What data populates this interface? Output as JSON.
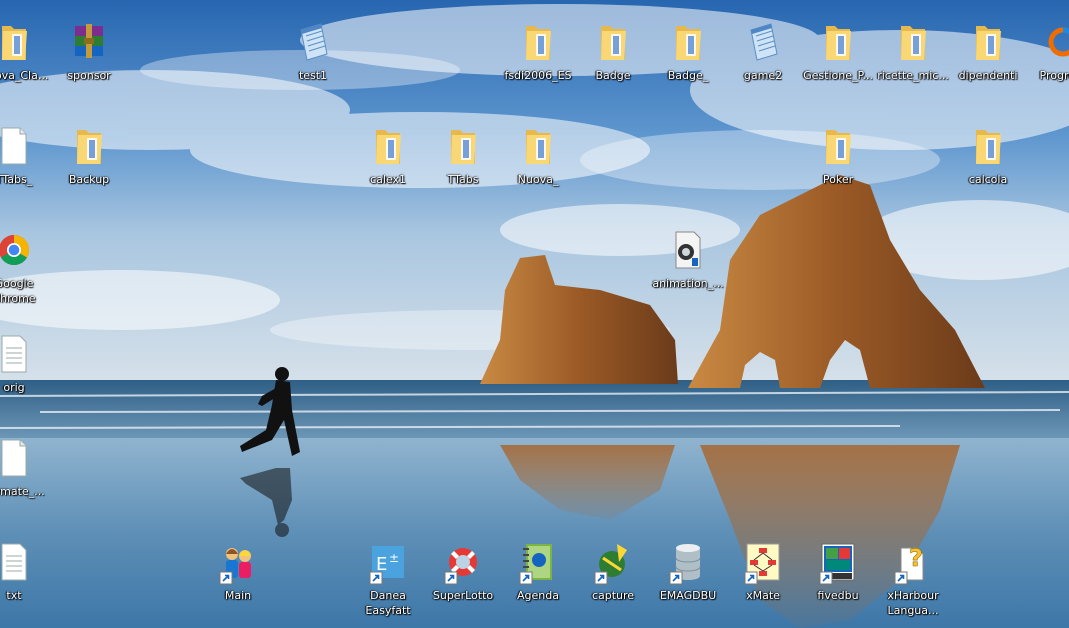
{
  "desktop": {
    "icons": [
      {
        "label": "Nuova_Cla...",
        "icon": "folder-icon"
      },
      {
        "label": "sponsor",
        "icon": "winrar-archive-icon"
      },
      {
        "label": "test1",
        "icon": "notepad-icon"
      },
      {
        "label": "fsdi2006_ES",
        "icon": "folder-icon"
      },
      {
        "label": "Badge",
        "icon": "folder-icon"
      },
      {
        "label": "Badge_",
        "icon": "folder-icon"
      },
      {
        "label": "game2",
        "icon": "notepad-icon"
      },
      {
        "label": "Gestione_P...",
        "icon": "folder-icon"
      },
      {
        "label": "ricette_mic...",
        "icon": "folder-icon"
      },
      {
        "label": "dipendenti",
        "icon": "folder-icon"
      },
      {
        "label": "Progress",
        "icon": "progress-app-icon"
      },
      {
        "label": "TTabs_",
        "icon": "document-icon"
      },
      {
        "label": "Backup",
        "icon": "folder-icon"
      },
      {
        "label": "calex1",
        "icon": "folder-icon"
      },
      {
        "label": "TTabs",
        "icon": "folder-icon"
      },
      {
        "label": "Nuova_",
        "icon": "folder-icon"
      },
      {
        "label": "Poker",
        "icon": "folder-icon"
      },
      {
        "label": "calcola",
        "icon": "folder-icon"
      },
      {
        "label": "Google Chrome",
        "icon": "chrome-icon"
      },
      {
        "label": "animation_...",
        "icon": "animation-file-icon"
      },
      {
        "label": "orig",
        "icon": "text-file-icon"
      },
      {
        "label": "Fermate_...",
        "icon": "document-icon"
      },
      {
        "label": "txt",
        "icon": "text-file-icon"
      },
      {
        "label": "Main",
        "icon": "people-app-icon"
      },
      {
        "label": "Danea Easyfatt",
        "icon": "easyfatt-app-icon"
      },
      {
        "label": "SuperLotto",
        "icon": "lifebuoy-icon"
      },
      {
        "label": "Agenda",
        "icon": "agenda-notebook-icon"
      },
      {
        "label": "capture",
        "icon": "capture-app-icon"
      },
      {
        "label": "EMAGDBU",
        "icon": "database-icon"
      },
      {
        "label": "xMate",
        "icon": "flowchart-app-icon"
      },
      {
        "label": "fivedbu",
        "icon": "fivewin-app-icon"
      },
      {
        "label": "xHarbour Langua...",
        "icon": "help-question-icon"
      }
    ]
  },
  "colors": {
    "sky_top": "#2d72bb",
    "sky_mid": "#8fb7db",
    "sea": "#3b6f94",
    "sand": "#7aa3c2",
    "rock": "#b06a2c",
    "folder": "#f3cf6a"
  }
}
